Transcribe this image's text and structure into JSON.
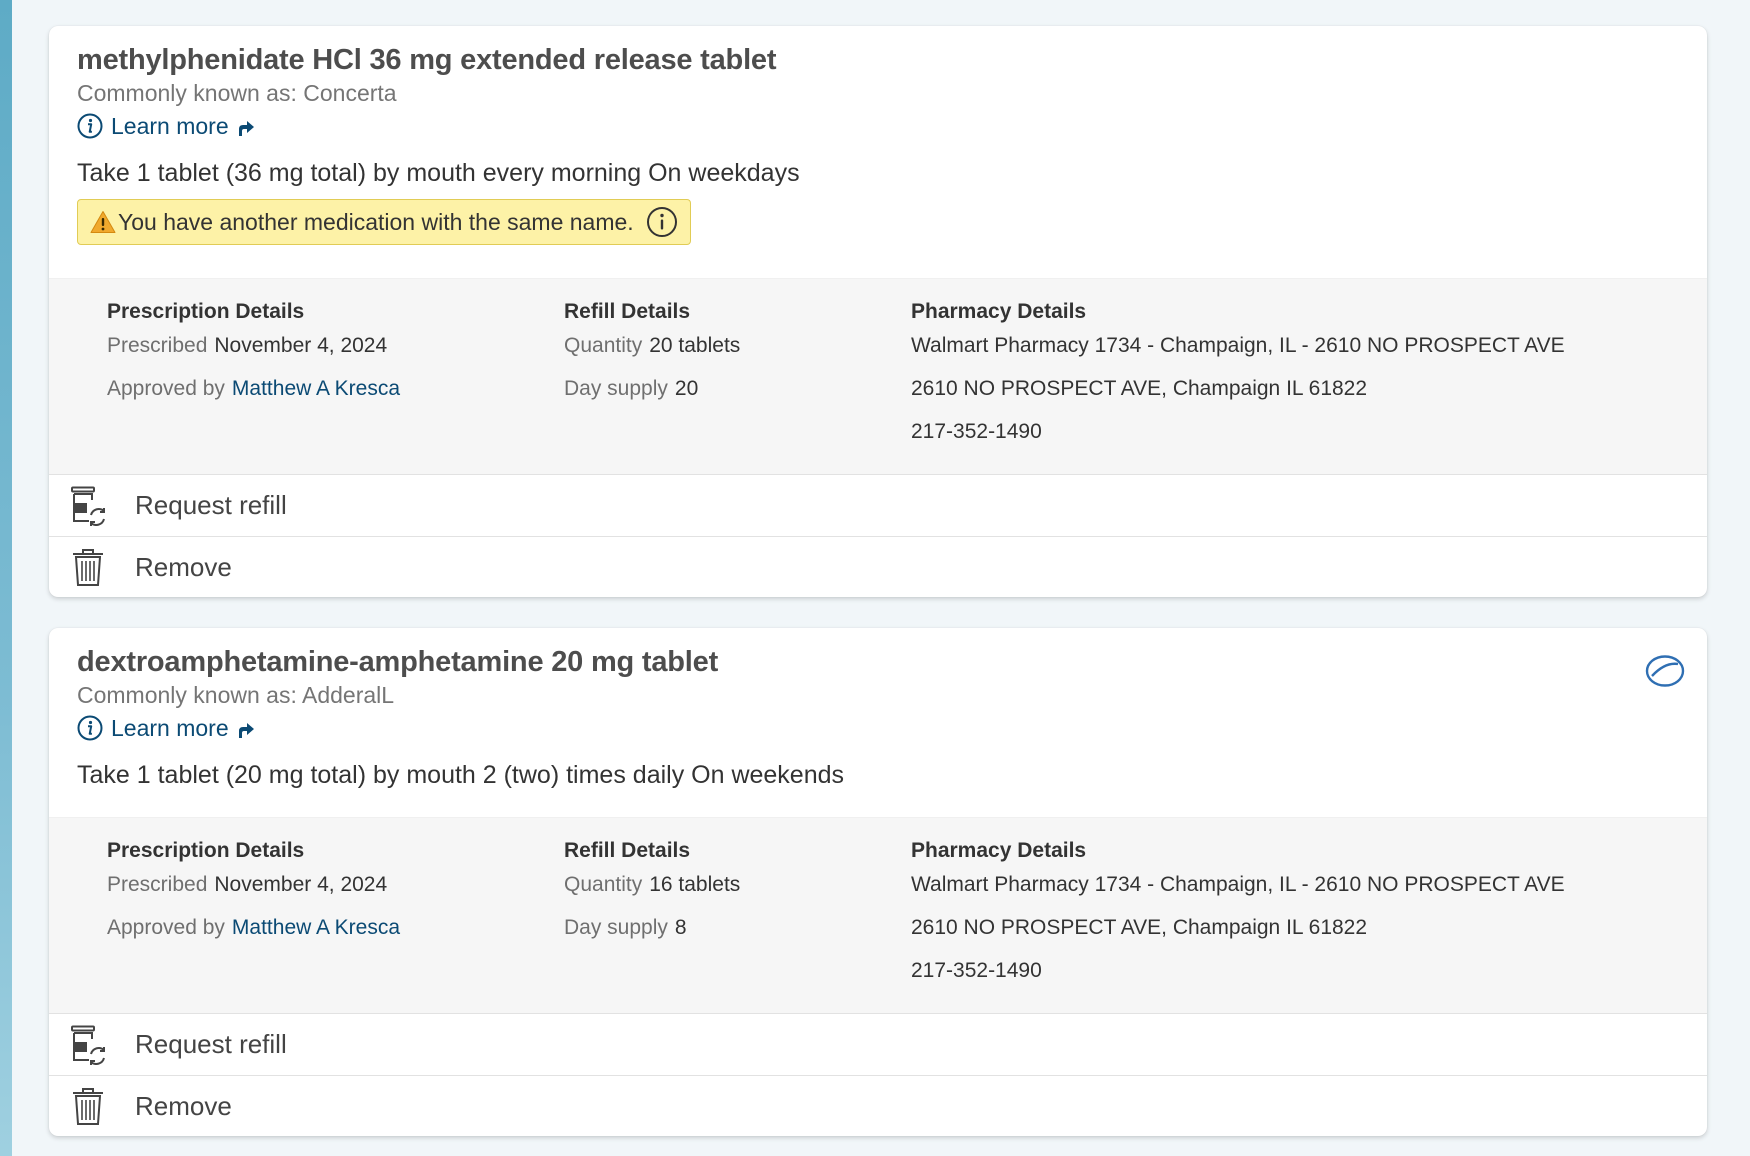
{
  "medications": [
    {
      "name": "methylphenidate HCl 36 mg extended release tablet",
      "known_as": "Commonly known as: Concerta",
      "learn_more": "Learn more",
      "instructions": "Take 1 tablet (36 mg total) by mouth every morning On weekdays",
      "warning": "You have another medication with the same name.",
      "prescription": {
        "heading": "Prescription Details",
        "prescribed_label": "Prescribed",
        "prescribed_value": "November 4, 2024",
        "approved_label": "Approved by",
        "approved_value": "Matthew A Kresca"
      },
      "refill": {
        "heading": "Refill Details",
        "quantity_label": "Quantity",
        "quantity_value": "20 tablets",
        "supply_label": "Day supply",
        "supply_value": "20"
      },
      "pharmacy": {
        "heading": "Pharmacy Details",
        "name": "Walmart Pharmacy 1734 - Champaign, IL - 2610 NO PROSPECT AVE",
        "address": "2610 NO PROSPECT AVE, Champaign IL 61822",
        "phone": "217-352-1490"
      },
      "actions": {
        "refill": "Request refill",
        "remove": "Remove"
      },
      "icons": [
        "info-icon",
        "external-link-icon",
        "warning-icon",
        "refill-bottle-icon",
        "trash-icon"
      ]
    },
    {
      "name": "dextroamphetamine-amphetamine 20 mg tablet",
      "known_as": "Commonly known as: AdderalL",
      "learn_more": "Learn more",
      "instructions": "Take 1 tablet (20 mg total) by mouth 2 (two) times daily On weekends",
      "prescription": {
        "heading": "Prescription Details",
        "prescribed_label": "Prescribed",
        "prescribed_value": "November 4, 2024",
        "approved_label": "Approved by",
        "approved_value": "Matthew A Kresca"
      },
      "refill": {
        "heading": "Refill Details",
        "quantity_label": "Quantity",
        "quantity_value": "16 tablets",
        "supply_label": "Day supply",
        "supply_value": "8"
      },
      "pharmacy": {
        "heading": "Pharmacy Details",
        "name": "Walmart Pharmacy 1734 - Champaign, IL - 2610 NO PROSPECT AVE",
        "address": "2610 NO PROSPECT AVE, Champaign IL 61822",
        "phone": "217-352-1490"
      },
      "actions": {
        "refill": "Request refill",
        "remove": "Remove"
      },
      "icons": [
        "pill-icon",
        "info-icon",
        "external-link-icon",
        "refill-bottle-icon",
        "trash-icon"
      ]
    }
  ],
  "colors": {
    "link": "#0b4a74",
    "warning_bg": "#fdf2a7",
    "warning_border": "#e1cc55",
    "details_bg": "#f6f6f6",
    "page_bg": "#f1f6f9",
    "pill_icon": "#2f6fb3"
  }
}
